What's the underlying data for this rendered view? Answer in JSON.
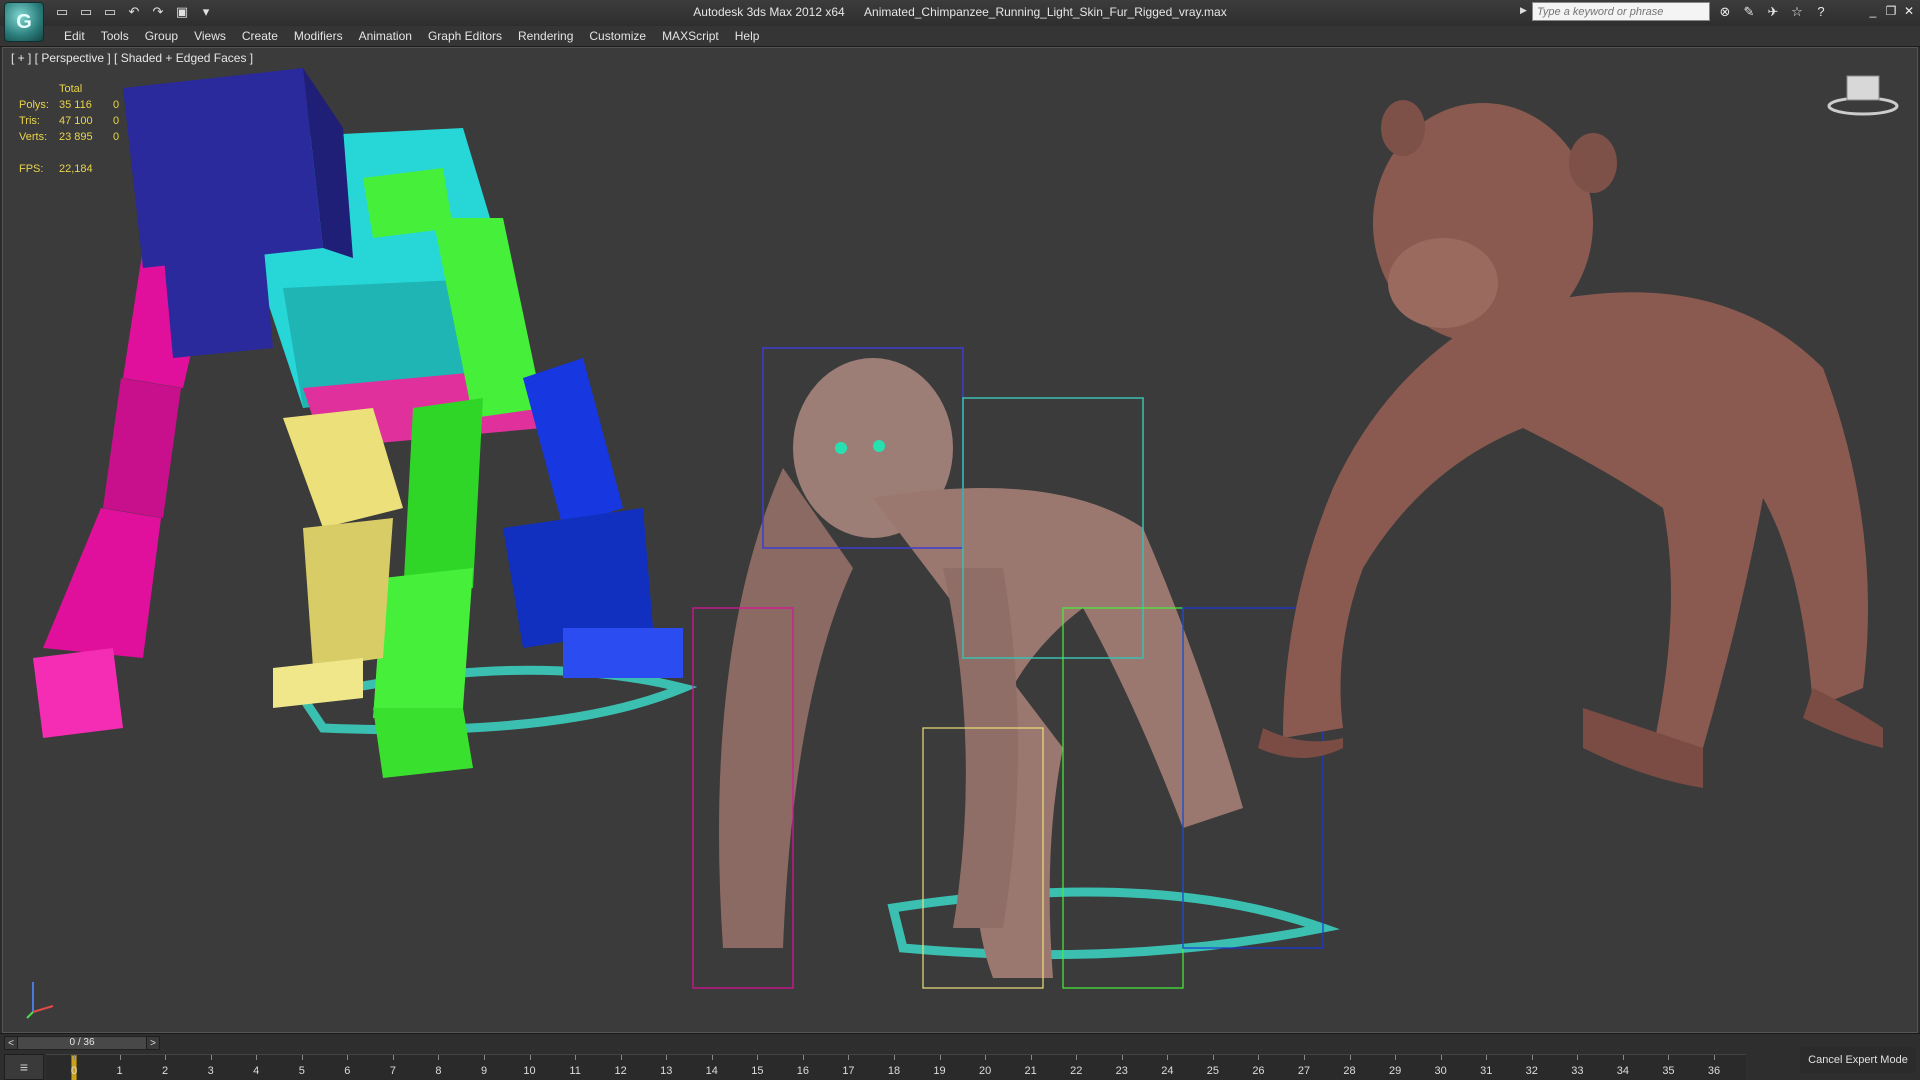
{
  "titlebar": {
    "app_name": "Autodesk 3ds Max  2012 x64",
    "file_name": "Animated_Chimpanzee_Running_Light_Skin_Fur_Rigged_vray.max",
    "logo_glyph": "G",
    "search_placeholder": "Type a keyword or phrase",
    "qat_icons": [
      "new-file-icon",
      "open-folder-icon",
      "save-icon",
      "undo-icon",
      "redo-icon",
      "project-icon",
      "dropdown-icon"
    ],
    "qat_glyphs": [
      "▭",
      "▭",
      "▭",
      "↶",
      "↷",
      "▣",
      "▾"
    ],
    "right_icons": [
      "binoculars-icon",
      "tools-icon",
      "exchange-icon",
      "favorites-star-icon",
      "help-icon"
    ],
    "right_glyphs": [
      "⊗",
      "✎",
      "✈",
      "☆",
      "?"
    ],
    "window_controls": [
      "_",
      "❐",
      "✕"
    ]
  },
  "menubar": {
    "items": [
      "Edit",
      "Tools",
      "Group",
      "Views",
      "Create",
      "Modifiers",
      "Animation",
      "Graph Editors",
      "Rendering",
      "Customize",
      "MAXScript",
      "Help"
    ]
  },
  "viewport": {
    "label": "[ + ] [ Perspective ] [ Shaded + Edged Faces ]",
    "stats": {
      "header": "Total",
      "rows": [
        {
          "k": "Polys:",
          "v": "35 116",
          "z": "0"
        },
        {
          "k": "Tris:",
          "v": "47 100",
          "z": "0"
        },
        {
          "k": "Verts:",
          "v": "23 895",
          "z": "0"
        }
      ],
      "fps_label": "FPS:",
      "fps_value": "22,184"
    },
    "colors": {
      "magenta": "#e0109c",
      "navy": "#2a2a9c",
      "cyan": "#27d6d6",
      "green": "#46f03a",
      "yellow": "#ece07a",
      "blue": "#1737e0",
      "chimp_skin": "#8a5a50"
    }
  },
  "timeline": {
    "slider_label": "0 / 36",
    "prev": "<",
    "next": ">",
    "current_frame": 0,
    "frame_end": 36,
    "ticks": [
      "0",
      "1",
      "2",
      "3",
      "4",
      "5",
      "6",
      "7",
      "8",
      "9",
      "10",
      "11",
      "12",
      "13",
      "14",
      "15",
      "16",
      "17",
      "18",
      "19",
      "20",
      "21",
      "22",
      "23",
      "24",
      "25",
      "26",
      "27",
      "28",
      "29",
      "30",
      "31",
      "32",
      "33",
      "34",
      "35",
      "36"
    ],
    "mini_curve_icon": "mini-curve-editor-icon",
    "cancel_expert": "Cancel Expert Mode"
  }
}
